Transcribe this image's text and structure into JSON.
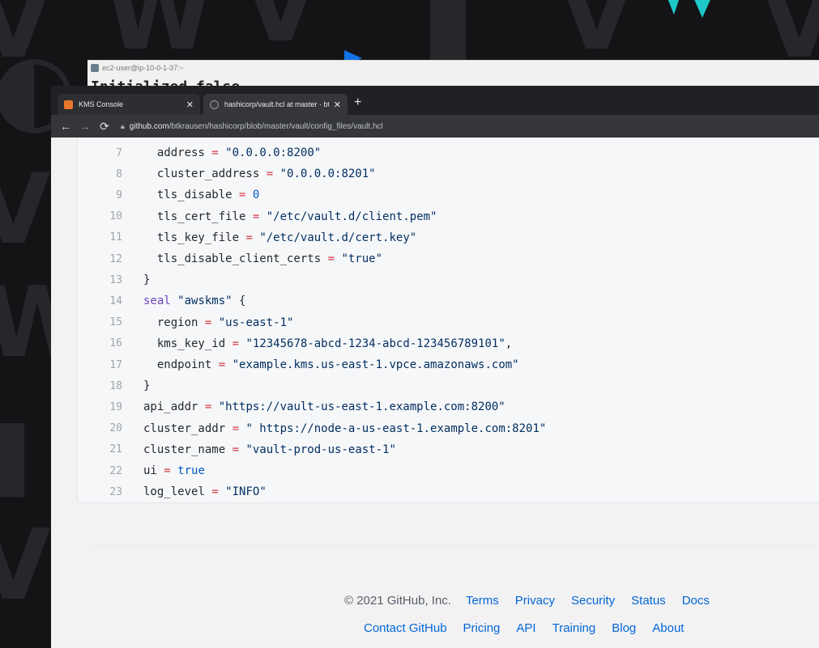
{
  "terminal": {
    "title": "ec2-user@ip-10-0-1-37:~",
    "visible_text": "Initialized false"
  },
  "browser": {
    "tabs": [
      {
        "label": "KMS Console",
        "active": false
      },
      {
        "label": "hashicorp/vault.hcl at master · bt",
        "active": true
      }
    ],
    "address": {
      "host": "github.com",
      "path": "/btkrausen/hashicorp/blob/master/vault/config_files/vault.hcl"
    }
  },
  "code": {
    "lines": [
      {
        "n": "7",
        "text": "  address = \"0.0.0.0:8200\""
      },
      {
        "n": "8",
        "text": "  cluster_address = \"0.0.0.0:8201\""
      },
      {
        "n": "9",
        "text": "  tls_disable = 0"
      },
      {
        "n": "10",
        "text": "  tls_cert_file = \"/etc/vault.d/client.pem\""
      },
      {
        "n": "11",
        "text": "  tls_key_file = \"/etc/vault.d/cert.key\""
      },
      {
        "n": "12",
        "text": "  tls_disable_client_certs = \"true\""
      },
      {
        "n": "13",
        "text": "}"
      },
      {
        "n": "14",
        "text": "seal \"awskms\" {"
      },
      {
        "n": "15",
        "text": "  region = \"us-east-1\""
      },
      {
        "n": "16",
        "text": "  kms_key_id = \"12345678-abcd-1234-abcd-123456789101\","
      },
      {
        "n": "17",
        "text": "  endpoint = \"example.kms.us-east-1.vpce.amazonaws.com\""
      },
      {
        "n": "18",
        "text": "}"
      },
      {
        "n": "19",
        "text": "api_addr = \"https://vault-us-east-1.example.com:8200\""
      },
      {
        "n": "20",
        "text": "cluster_addr = \" https://node-a-us-east-1.example.com:8201\""
      },
      {
        "n": "21",
        "text": "cluster_name = \"vault-prod-us-east-1\""
      },
      {
        "n": "22",
        "text": "ui = true"
      },
      {
        "n": "23",
        "text": "log_level = \"INFO\""
      }
    ]
  },
  "footer": {
    "copyright": "© 2021 GitHub, Inc.",
    "row1_links": [
      "Terms",
      "Privacy",
      "Security",
      "Status",
      "Docs"
    ],
    "row2_links": [
      "Contact GitHub",
      "Pricing",
      "API",
      "Training",
      "Blog",
      "About"
    ]
  },
  "colors": {
    "link": "#0366d6",
    "string": "#032f62",
    "keyword": "#6f42c1",
    "constant": "#005cc5",
    "teal_logo": "#1ec8c8"
  }
}
